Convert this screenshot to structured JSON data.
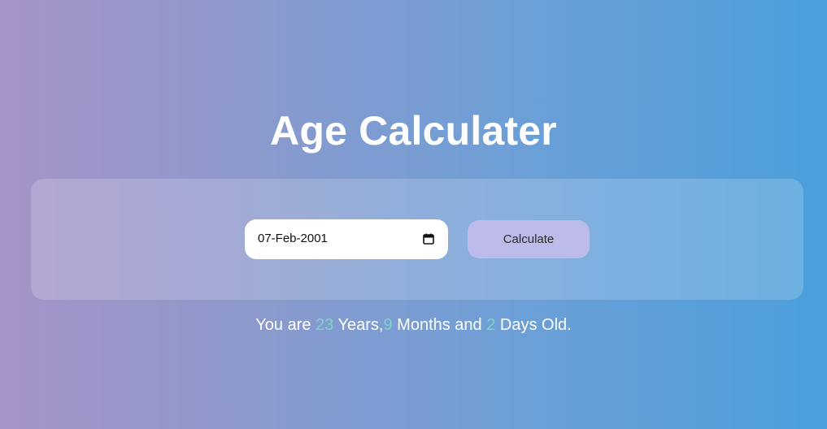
{
  "header": {
    "title": "Age Calculater"
  },
  "form": {
    "date_value": "07-Feb-2001",
    "calculate_label": "Calculate",
    "calendar_icon": "calendar-icon"
  },
  "result": {
    "prefix": "You are ",
    "years": "23",
    "years_label": " Years,",
    "months": "9",
    "months_label": " Months and ",
    "days": "2",
    "days_label": " Days Old."
  },
  "colors": {
    "background_start": "#a694c8",
    "background_end": "#4a9fdc",
    "button_bg": "#bcbbe9",
    "number_accent": "#7fd4c6",
    "text": "#ffffff"
  }
}
